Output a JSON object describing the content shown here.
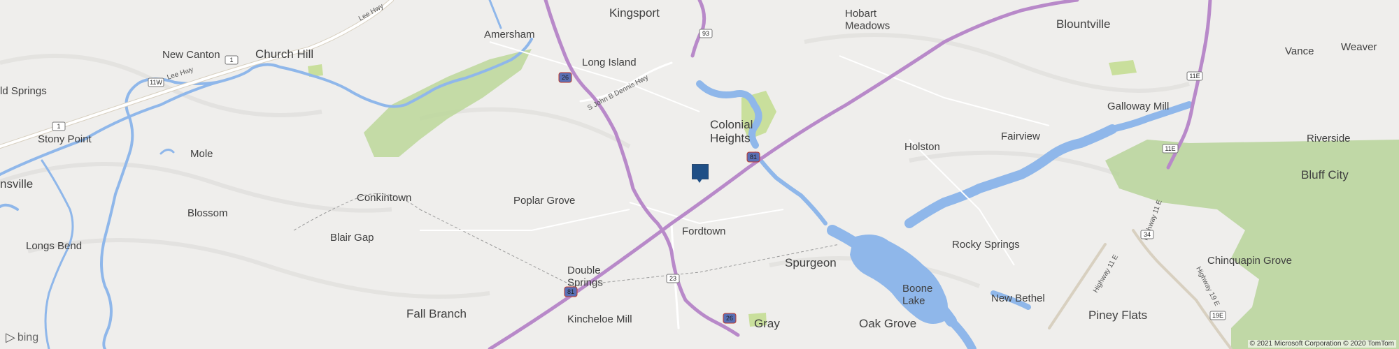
{
  "places": [
    {
      "id": "kingsport",
      "name": "Kingsport"
    },
    {
      "id": "amersham",
      "name": "Amersham"
    },
    {
      "id": "church-hill",
      "name": "Church Hill"
    },
    {
      "id": "new-canton",
      "name": "New Canton"
    },
    {
      "id": "long-island",
      "name": "Long Island"
    },
    {
      "id": "hobart-meadows",
      "name": "Hobart\nMeadows"
    },
    {
      "id": "blountville",
      "name": "Blountville"
    },
    {
      "id": "vance",
      "name": "Vance"
    },
    {
      "id": "weaver",
      "name": "Weaver"
    },
    {
      "id": "galloway-mill",
      "name": "Galloway Mill"
    },
    {
      "id": "colonial-heights",
      "name": "Colonial\nHeights"
    },
    {
      "id": "holston",
      "name": "Holston"
    },
    {
      "id": "fairview",
      "name": "Fairview"
    },
    {
      "id": "riverside",
      "name": "Riverside"
    },
    {
      "id": "bluff-city",
      "name": "Bluff City"
    },
    {
      "id": "stony-point",
      "name": "Stony Point"
    },
    {
      "id": "mole",
      "name": "Mole"
    },
    {
      "id": "old-springs",
      "name": "ld Springs"
    },
    {
      "id": "nsville",
      "name": "nsville"
    },
    {
      "id": "conkintown",
      "name": "Conkintown"
    },
    {
      "id": "poplar-grove",
      "name": "Poplar Grove"
    },
    {
      "id": "blossom",
      "name": "Blossom"
    },
    {
      "id": "fordtown",
      "name": "Fordtown"
    },
    {
      "id": "longs-bend",
      "name": "Longs Bend"
    },
    {
      "id": "blair-gap",
      "name": "Blair Gap"
    },
    {
      "id": "rocky-springs",
      "name": "Rocky Springs"
    },
    {
      "id": "spurgeon",
      "name": "Spurgeon"
    },
    {
      "id": "double-springs",
      "name": "Double\nSprings"
    },
    {
      "id": "chinquapin-grove",
      "name": "Chinquapin Grove"
    },
    {
      "id": "boone-lake",
      "name": "Boone\nLake"
    },
    {
      "id": "new-bethel",
      "name": "New Bethel"
    },
    {
      "id": "fall-branch",
      "name": "Fall Branch"
    },
    {
      "id": "kincheloe-mill",
      "name": "Kincheloe Mill"
    },
    {
      "id": "gray",
      "name": "Gray"
    },
    {
      "id": "oak-grove",
      "name": "Oak Grove"
    },
    {
      "id": "piney-flats",
      "name": "Piney Flats"
    }
  ],
  "roads": {
    "lee_hwy_1": "Lee Hwy",
    "lee_hwy_2": "Lee Hwy",
    "john_dennis": "S John B Dennis Hwy",
    "hwy11e_a": "Highway 11 E",
    "hwy11e_b": "Highway 11 E",
    "hwy19e": "Highway 19 E"
  },
  "shields": {
    "s1a": "1",
    "s1b": "1",
    "s11w": "11W",
    "s26a": "26",
    "s26b": "26",
    "s93": "93",
    "s81a": "81",
    "s81b": "81",
    "s23": "23",
    "s11e": "11E",
    "s11e_b": "11E",
    "s34": "34",
    "s19e": "19E"
  },
  "attribution": {
    "logo": "bing",
    "copyright": "© 2021 Microsoft Corporation © 2020 TomTom"
  },
  "colors": {
    "background": "#efeeec",
    "water": "#8fb7ea",
    "interstate": "#b889c9",
    "highway": "#ffffff",
    "park": "#bcd79a",
    "marker": "#1f4f86"
  }
}
